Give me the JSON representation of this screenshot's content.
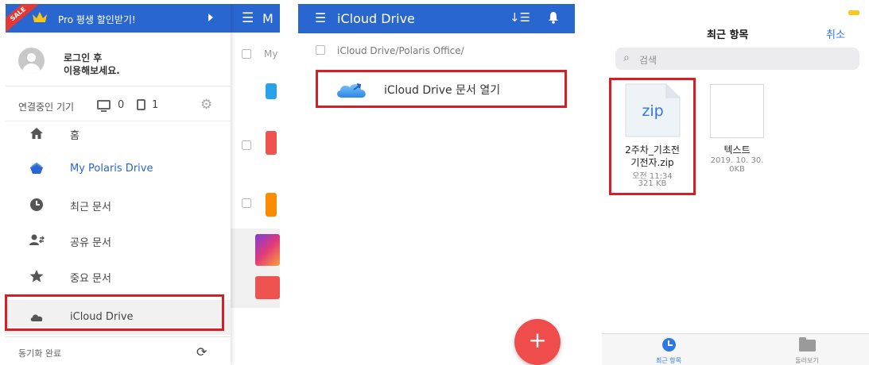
{
  "panel1": {
    "background_app": {
      "title_partial": "M",
      "row_text": "My"
    },
    "promo": {
      "sale_badge": "SALE",
      "text": "Pro 평생 할인받기!"
    },
    "profile": {
      "line1": "로그인 후",
      "line2": "이용해보세요."
    },
    "devices": {
      "label": "연결중인 기기",
      "pc_count": "0",
      "mobile_count": "1"
    },
    "nav": [
      {
        "label": "홈",
        "icon": "home-icon"
      },
      {
        "label": "My Polaris Drive",
        "icon": "polaris-drive-icon",
        "active": true
      },
      {
        "label": "최근 문서",
        "icon": "clock-icon"
      },
      {
        "label": "공유 문서",
        "icon": "share-users-icon"
      },
      {
        "label": "중요 문서",
        "icon": "star-icon"
      },
      {
        "label": "iCloud Drive",
        "icon": "cloud-icon",
        "highlighted": true
      }
    ],
    "sync_status": "동기화 완료",
    "colors": {
      "brand_blue": "#2a66d0",
      "highlight_red": "#d32027"
    }
  },
  "panel2": {
    "title": "iCloud Drive",
    "path": "iCloud Drive/Polaris Office/",
    "open_item": "iCloud Drive 문서 열기",
    "fab": "+",
    "colors": {
      "fab_red": "#ef4c4c"
    }
  },
  "panel3": {
    "nav_title": "최근 항목",
    "cancel": "취소",
    "search_placeholder": "검색",
    "files": [
      {
        "thumb_text": "zip",
        "name_line1": "2주차_기초전",
        "name_line2": "기전자.zip",
        "meta1": "오전 11:34",
        "meta2": "321 KB",
        "highlighted": true
      },
      {
        "name": "텍스트",
        "meta1": "2019. 10. 30.",
        "meta2": "0KB"
      }
    ],
    "tabs": [
      {
        "label": "최근 항목",
        "active": true
      },
      {
        "label": "둘러보기",
        "active": false
      }
    ]
  }
}
